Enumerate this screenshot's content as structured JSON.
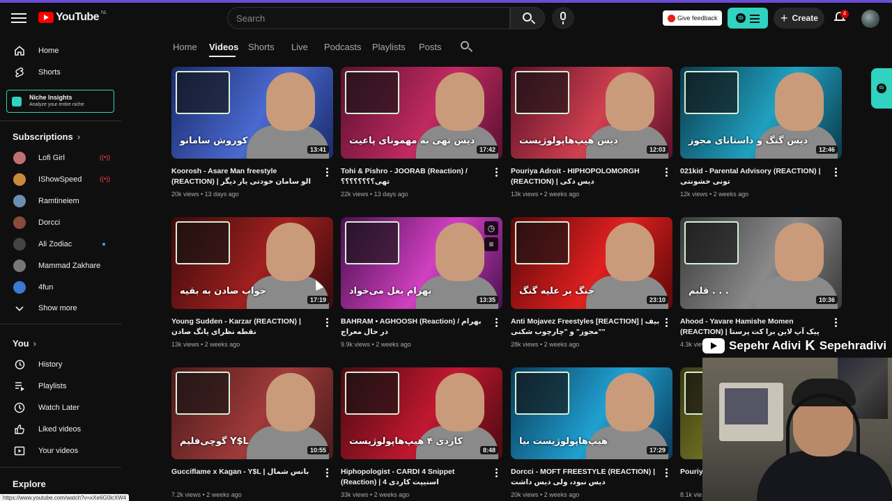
{
  "header": {
    "logo_text": "YouTube",
    "country_code": "NL",
    "search_placeholder": "Search",
    "feedback_label": "Give feedback",
    "create_label": "Create",
    "notification_count": "4",
    "extension_badge": "tb"
  },
  "sidebar": {
    "main": [
      {
        "label": "Home",
        "icon": "home-icon"
      },
      {
        "label": "Shorts",
        "icon": "shorts-icon"
      }
    ],
    "niche": {
      "title": "Niche Insights",
      "subtitle": "Analyze your entire niche"
    },
    "subscriptions_title": "Subscriptions",
    "subscriptions": [
      {
        "label": "Lofi Girl",
        "status": "live",
        "color": "#c07070"
      },
      {
        "label": "IShowSpeed",
        "status": "live",
        "color": "#c98a3a"
      },
      {
        "label": "Ramtineiem",
        "status": "",
        "color": "#6b8fb0"
      },
      {
        "label": "Dorcci",
        "status": "",
        "color": "#8b4a3a"
      },
      {
        "label": "Ali Zodiac",
        "status": "new",
        "color": "#444444"
      },
      {
        "label": "Mammad Zakhare",
        "status": "",
        "color": "#777777"
      },
      {
        "label": "4fun",
        "status": "",
        "color": "#3a7ad0"
      }
    ],
    "show_more": "Show more",
    "you_title": "You",
    "you_items": [
      {
        "label": "History",
        "icon": "history-icon"
      },
      {
        "label": "Playlists",
        "icon": "playlists-icon"
      },
      {
        "label": "Watch Later",
        "icon": "watch-later-icon"
      },
      {
        "label": "Liked videos",
        "icon": "liked-icon"
      },
      {
        "label": "Your videos",
        "icon": "your-videos-icon"
      }
    ],
    "explore_title": "Explore"
  },
  "tabs": [
    "Home",
    "Videos",
    "Shorts",
    "Live",
    "Podcasts",
    "Playlists",
    "Posts"
  ],
  "active_tab": "Videos",
  "videos": [
    {
      "title": "Koorosh - Asare Man freestyle (REACTION) | الو سامان خودتی یار دیگر تکرار شد",
      "views": "20k views",
      "age": "13 days ago",
      "duration": "13:41",
      "thumb_text": "کوروش سامانو",
      "bg1": "#1a2a6a",
      "bg2": "#4a6ad0"
    },
    {
      "title": "Tohi & Pishro - JOORAB (Reaction) / تهی؟؟؟؟؟؟؟؟",
      "views": "22k views",
      "age": "13 days ago",
      "duration": "17:42",
      "thumb_text": "دیس تهی به مهمونای پاعیت",
      "bg1": "#5a1030",
      "bg2": "#c02a60"
    },
    {
      "title": "Pouriya Adroit - HIPHOPOLOMORGH (REACTION) | دیس دکی",
      "views": "13k views",
      "age": "2 weeks ago",
      "duration": "12:03",
      "thumb_text": "دیس هیپ‌هاپولوژیست",
      "bg1": "#5a1028",
      "bg2": "#d04050"
    },
    {
      "title": "021kid - Parental Advisory (REACTION) | تونی خشونتی",
      "views": "12k views",
      "age": "2 weeks ago",
      "duration": "12:46",
      "thumb_text": "دیس گنگ و داستانای مجوز",
      "bg1": "#0a3a4a",
      "bg2": "#20a0c0"
    },
    {
      "title": "Young Sudden - Karzar (REACTION) | نقطه نظرای یانگ صادن",
      "views": "13k views",
      "age": "2 weeks ago",
      "duration": "17:19",
      "thumb_text": "جواب صادن به بقیه",
      "bg1": "#3a0a0a",
      "bg2": "#a02020"
    },
    {
      "title": "BAHRAM • AGHOOSH (Reaction) / بهرام در حال معراج",
      "views": "9.9k views",
      "age": "2 weeks ago",
      "duration": "13:35",
      "thumb_text": "بهرام بغل می‌خواد",
      "bg1": "#4a1050",
      "bg2": "#d040c0"
    },
    {
      "title": "Anti Mojavez Freestyles [REACTION] | بیف \"مجوز\" و \"چارچوب شکنی\"",
      "views": "28k views",
      "age": "2 weeks ago",
      "duration": "23:10",
      "thumb_text": "جنگ بر علیه گنگ",
      "bg1": "#5a0808",
      "bg2": "#e02020"
    },
    {
      "title": "Ahood - Yavare Hamishe Momen (REACTION) | پیک آپ لاین برا کت پرستا",
      "views": "4.3k views",
      "age": "",
      "duration": "10:36",
      "thumb_text": "قلبم . . .",
      "bg1": "#3a3a3a",
      "bg2": "#8a8a8a"
    },
    {
      "title": "Gucciflame x Kagan - Y$L | بانس شمال",
      "views": "7.2k views",
      "age": "2 weeks ago",
      "duration": "10:55",
      "thumb_text": "گوچی‌فلیم Y$L",
      "bg1": "#4a1a1a",
      "bg2": "#a03a3a"
    },
    {
      "title": "Hiphopologist - CARDI 4 Snippet (Reaction) | اسنیپت کاردی 4",
      "views": "33k views",
      "age": "2 weeks ago",
      "duration": "8:48",
      "thumb_text": "کاردی ۴ هیپ‌هاپولوژیست",
      "bg1": "#4a0a10",
      "bg2": "#c01830"
    },
    {
      "title": "Dorcci - MOFT FREESTYLE (REACTION) | دیس نبود، ولی دیس داشت",
      "views": "20k views",
      "age": "2 weeks ago",
      "duration": "17:29",
      "thumb_text": "هیپ‌هاپولوژیست بیا",
      "bg1": "#0a3a5a",
      "bg2": "#20a0d0"
    },
    {
      "title": "Pouriy... [REAC...",
      "views": "8.1k vie...",
      "age": "",
      "duration": "",
      "thumb_text": "",
      "bg1": "#3a3a10",
      "bg2": "#8a8a30"
    }
  ],
  "overlay": {
    "watermark_name": "Sepehr Adivi",
    "watermark_handle": "Sepehradivi",
    "status_url": "https://www.youtube.com/watch?v=xXe6G0lcXW4"
  }
}
